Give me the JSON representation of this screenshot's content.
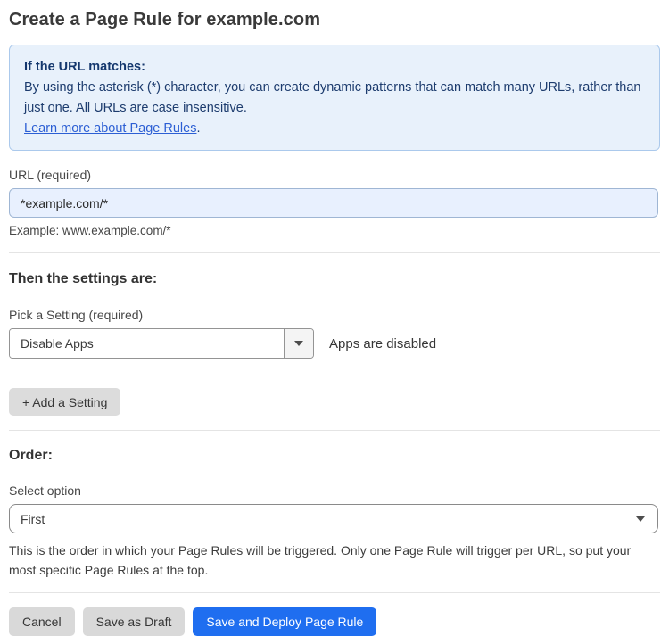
{
  "page": {
    "title": "Create a Page Rule for example.com"
  },
  "info_box": {
    "heading": "If the URL matches:",
    "body": "By using the asterisk (*) character, you can create dynamic patterns that can match many URLs, rather than just one. All URLs are case insensitive.",
    "link_label": "Learn more about Page Rules",
    "link_suffix": "."
  },
  "url_field": {
    "label": "URL (required)",
    "value": "*example.com/*",
    "helper": "Example: www.example.com/*"
  },
  "settings_section": {
    "heading": "Then the settings are:",
    "setting_label": "Pick a Setting (required)",
    "setting_value": "Disable Apps",
    "setting_status": "Apps are disabled",
    "add_setting_label": "+ Add a Setting"
  },
  "order_section": {
    "heading": "Order:",
    "select_label": "Select option",
    "select_value": "First",
    "helper": "This is the order in which your Page Rules will be triggered. Only one Page Rule will trigger per URL, so put your most specific Page Rules at the top."
  },
  "footer": {
    "cancel_label": "Cancel",
    "save_draft_label": "Save as Draft",
    "save_deploy_label": "Save and Deploy Page Rule"
  },
  "colors": {
    "info_bg": "#e8f1fb",
    "info_border": "#abc9ec",
    "info_text": "#1d3c6e",
    "link_blue": "#2c5fd4",
    "input_bg": "#e8f0fe",
    "primary_blue": "#1f6ef0",
    "button_gray": "#d9d9d9"
  },
  "icons": {
    "dropdown_caret": "caret-down"
  }
}
